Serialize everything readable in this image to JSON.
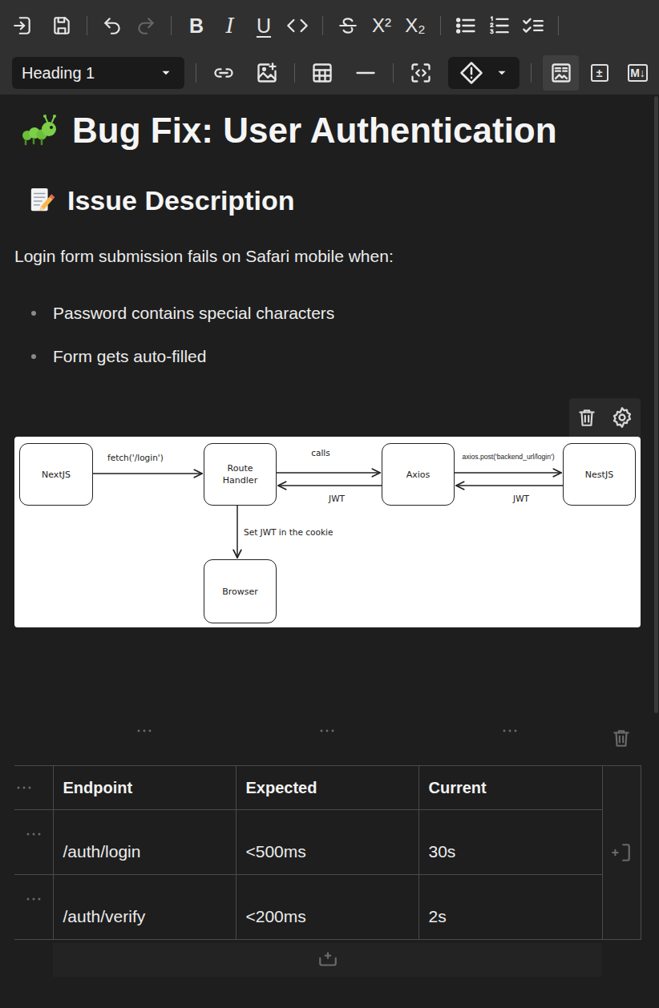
{
  "toolbar": {
    "undo": {
      "disabled": false
    },
    "redo": {
      "disabled": true
    },
    "format_buttons": [
      {
        "label": "B"
      },
      {
        "label": "I"
      },
      {
        "label": "U"
      }
    ],
    "script_buttons": [
      {
        "label": "X²"
      },
      {
        "label": "X₂"
      }
    ],
    "block_type": "Heading 1",
    "view_buttons": [
      {
        "kind": "icon",
        "selected": true
      },
      {
        "kind": "text",
        "label": "±",
        "selected": false
      },
      {
        "kind": "text",
        "label": "M↓",
        "selected": false
      }
    ]
  },
  "document": {
    "title": "Bug Fix: User Authentication",
    "section_heading": "Issue Description",
    "paragraph": "Login form submission fails on Safari mobile when:",
    "bullets": [
      "Password contains special characters",
      "Form gets auto-filled"
    ]
  },
  "diagram": {
    "nodes": [
      {
        "label": "NextJS"
      },
      {
        "label": "Route Handler"
      },
      {
        "label": "Axios"
      },
      {
        "label": "NestJS"
      },
      {
        "label": "Browser"
      }
    ],
    "edges": [
      {
        "label": "fetch('/login')"
      },
      {
        "label": "calls"
      },
      {
        "label": "JWT"
      },
      {
        "label": "axios.post('backend_url/login')"
      },
      {
        "label": "JWT"
      },
      {
        "label": "Set JWT in the cookie"
      }
    ]
  },
  "table": {
    "columns": [
      "Endpoint",
      "Expected",
      "Current"
    ],
    "rows": [
      [
        "/auth/login",
        "<500ms",
        "30s"
      ],
      [
        "/auth/verify",
        "<200ms",
        "2s"
      ]
    ]
  }
}
